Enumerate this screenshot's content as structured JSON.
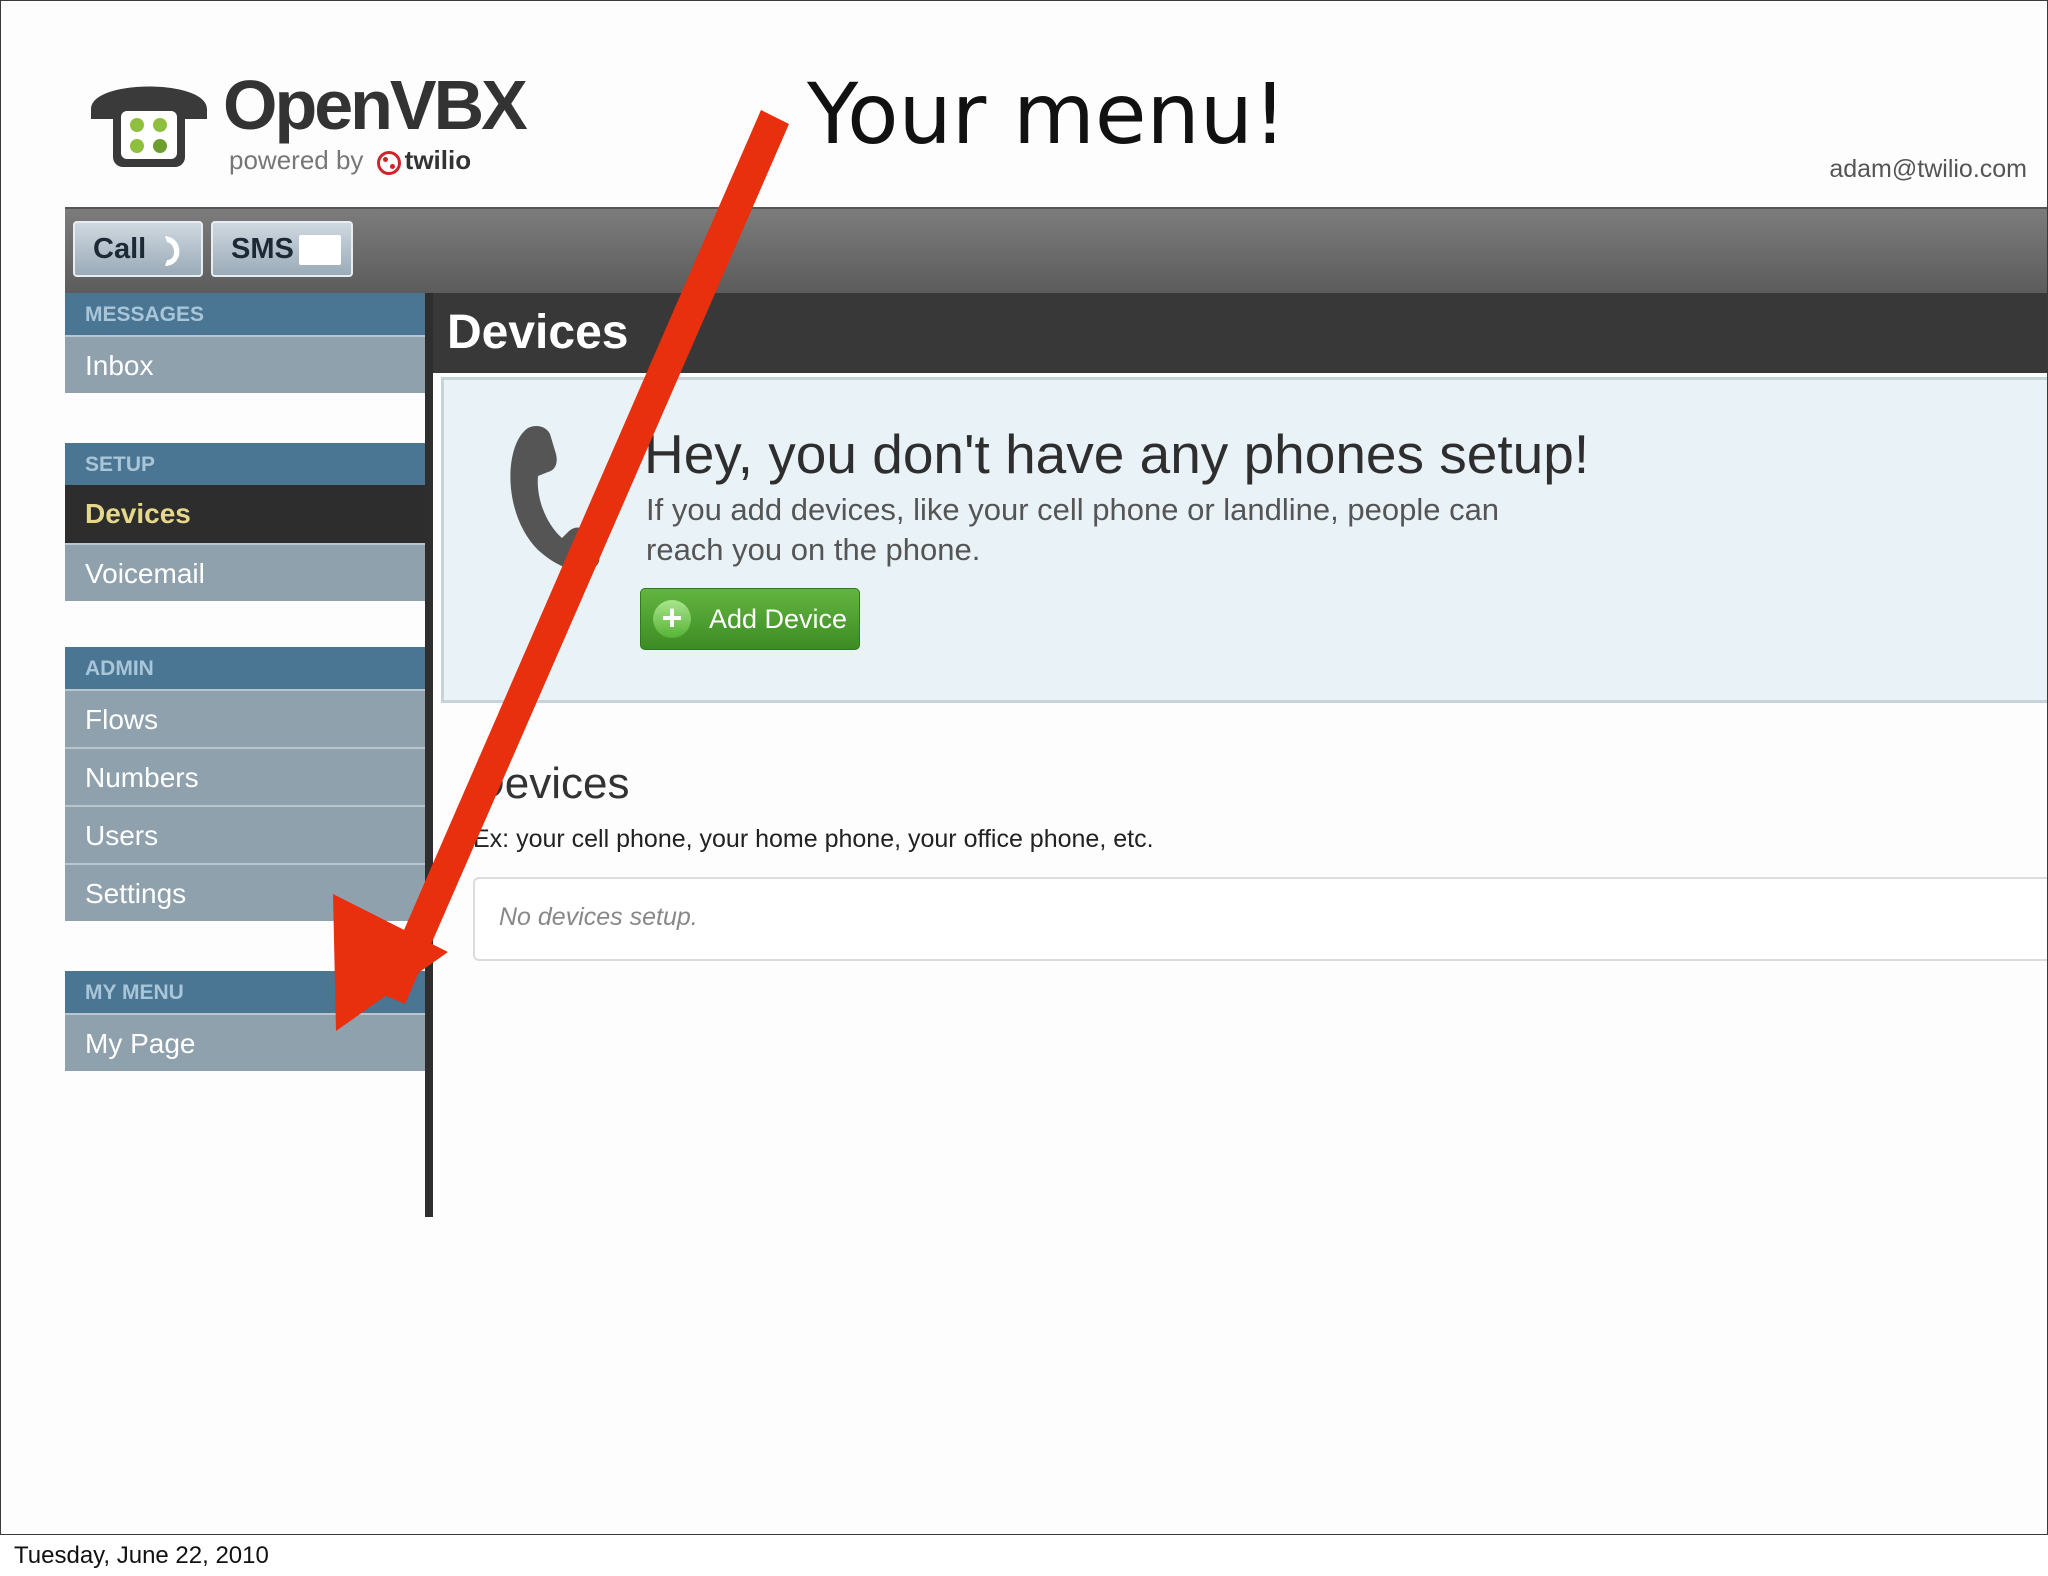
{
  "slide": {
    "annotation": "Your menu!",
    "footer_date": "Tuesday, June 22, 2010"
  },
  "brand": {
    "name": "OpenVBX",
    "powered_by": "powered by",
    "partner": "twilio",
    "accent": "#d2232a"
  },
  "header": {
    "user_email": "adam@twilio.com"
  },
  "toolbar": {
    "call_label": "Call",
    "sms_label": "SMS"
  },
  "sidebar": {
    "groups": [
      {
        "header": "MESSAGES",
        "items": [
          {
            "label": "Inbox",
            "active": false
          }
        ]
      },
      {
        "header": "SETUP",
        "items": [
          {
            "label": "Devices",
            "active": true
          },
          {
            "label": "Voicemail",
            "active": false
          }
        ]
      },
      {
        "header": "ADMIN",
        "items": [
          {
            "label": "Flows",
            "active": false
          },
          {
            "label": "Numbers",
            "active": false
          },
          {
            "label": "Users",
            "active": false
          },
          {
            "label": "Settings",
            "active": false
          }
        ]
      },
      {
        "header": "MY MENU",
        "items": [
          {
            "label": "My Page",
            "active": false
          }
        ]
      }
    ]
  },
  "main": {
    "title": "Devices",
    "hero": {
      "title": "Hey, you don't have any phones setup!",
      "description": "If you add devices, like your cell phone or landline, people can reach you on the phone.",
      "add_button": "Add Device"
    },
    "devices": {
      "heading": "Devices",
      "hint": "Ex: your cell phone, your home phone, your office phone, etc.",
      "empty": "No devices setup."
    }
  },
  "colors": {
    "sidebar_header": "#4a7593",
    "sidebar_item": "#8fa1ad",
    "active_text": "#e6d88a",
    "add_button": "#4aa02c",
    "arrow": "#e8300e"
  }
}
